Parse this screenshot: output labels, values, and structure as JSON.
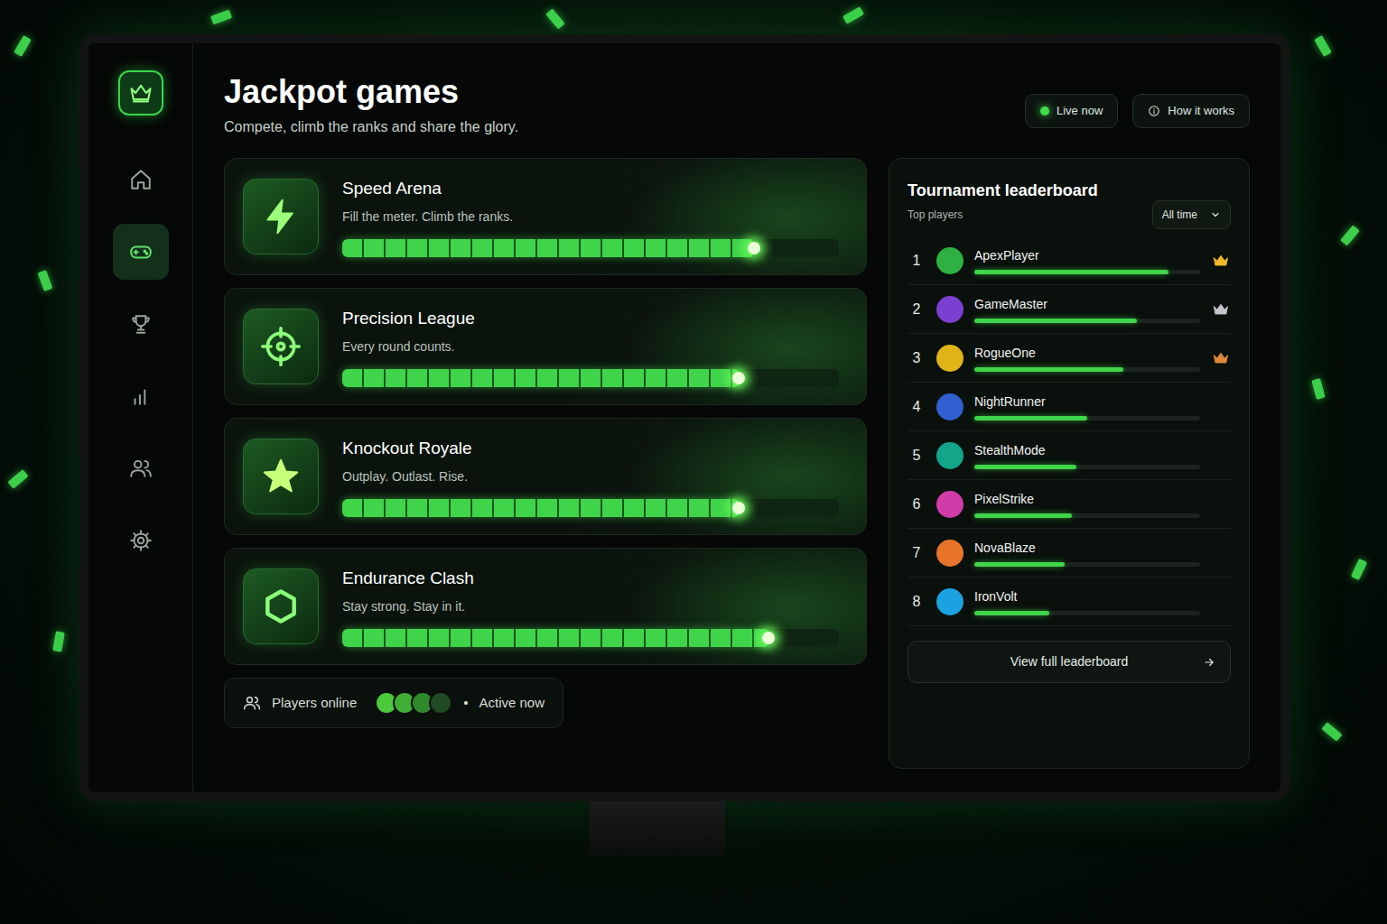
{
  "sidebar": {
    "items": [
      {
        "selected": false
      },
      {
        "selected": true
      },
      {
        "selected": false
      },
      {
        "selected": false
      },
      {
        "selected": false
      },
      {
        "selected": false
      }
    ]
  },
  "header": {
    "title": "Jackpot games",
    "subtitle": "Compete, climb the ranks and share the glory."
  },
  "status": {
    "live": {
      "label": "Live now",
      "on": true
    },
    "help": {
      "label": "How it works"
    }
  },
  "games": [
    {
      "title": "Speed Arena",
      "tagline": "Fill the meter. Climb the ranks.",
      "level": 0.83
    },
    {
      "title": "Precision League",
      "tagline": "Every round counts.",
      "level": 0.8
    },
    {
      "title": "Knockout Royale",
      "tagline": "Outplay. Outlast. Rise.",
      "level": 0.8
    },
    {
      "title": "Endurance Clash",
      "tagline": "Stay strong. Stay in it.",
      "level": 0.86
    }
  ],
  "players": {
    "label": "Players online",
    "avatars": [
      {
        "color": "#4cc93a"
      },
      {
        "color": "#3fae34"
      },
      {
        "color": "#2f8a2c"
      },
      {
        "color": "#1f4a22"
      }
    ],
    "separator": "•",
    "status": "Active now"
  },
  "leaderboard": {
    "title": "Tournament leaderboard",
    "subtitle": "Top players",
    "filter": "All time",
    "rows": [
      {
        "rank": "1",
        "name": "ApexPlayer",
        "color": "#2cb142",
        "level": 0.86,
        "crown": true,
        "crown_color": "#f0b92a"
      },
      {
        "rank": "2",
        "name": "GameMaster",
        "color": "#7b3fd1",
        "level": 0.72,
        "crown": true,
        "crown_color": "#c4c6cc"
      },
      {
        "rank": "3",
        "name": "RogueOne",
        "color": "#e0b416",
        "level": 0.66,
        "crown": true,
        "crown_color": "#e0873a"
      },
      {
        "rank": "4",
        "name": "NightRunner",
        "color": "#2f5fd0",
        "level": 0.5,
        "crown": false
      },
      {
        "rank": "5",
        "name": "StealthMode",
        "color": "#12a58a",
        "level": 0.45,
        "crown": false
      },
      {
        "rank": "6",
        "name": "PixelStrike",
        "color": "#d03ca8",
        "level": 0.43,
        "crown": false
      },
      {
        "rank": "7",
        "name": "NovaBlaze",
        "color": "#e8742a",
        "level": 0.4,
        "crown": false
      },
      {
        "rank": "8",
        "name": "IronVolt",
        "color": "#1aa3e0",
        "level": 0.33,
        "crown": false
      }
    ],
    "button": "View full leaderboard"
  }
}
